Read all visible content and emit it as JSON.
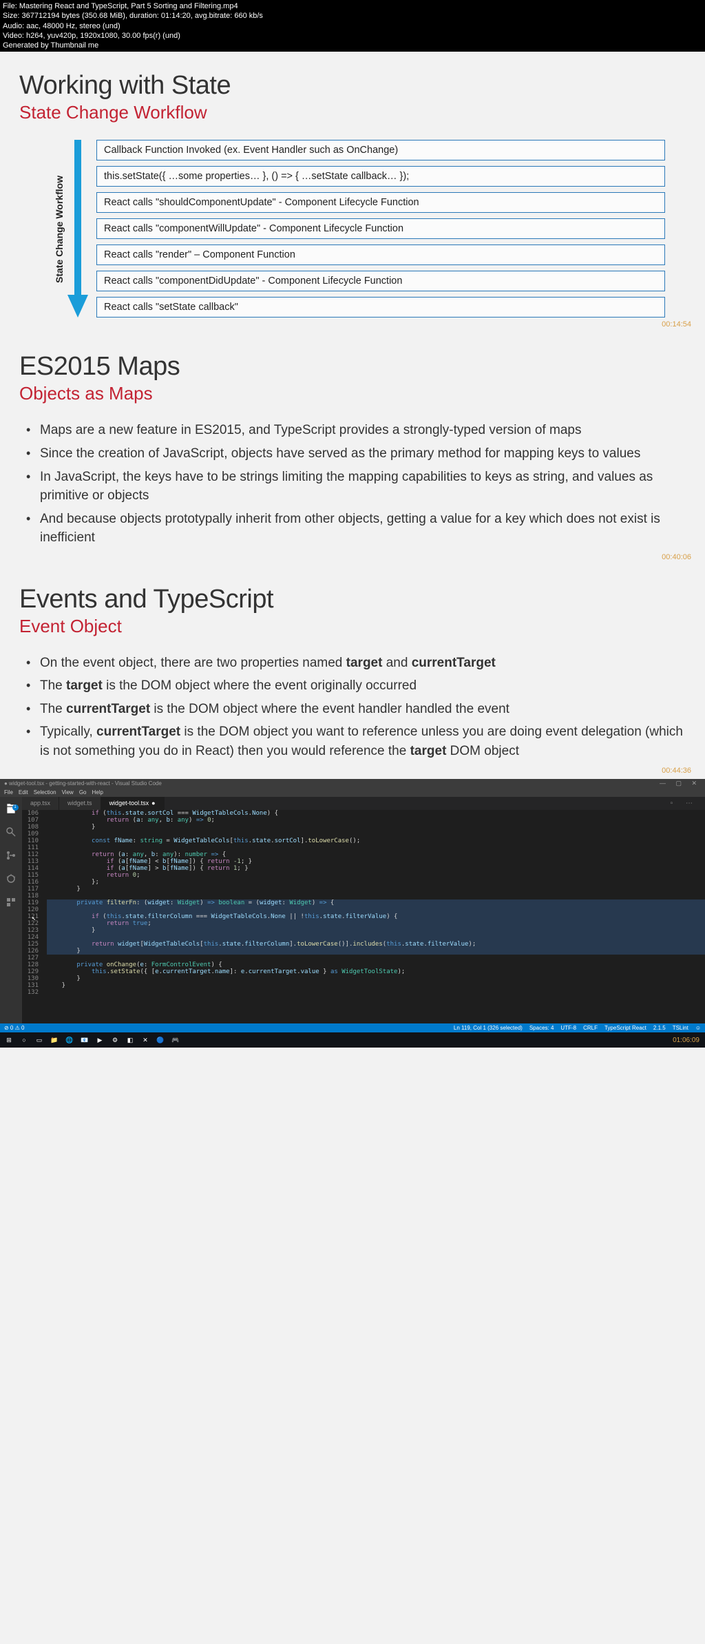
{
  "metadata": {
    "file": "File: Mastering React and TypeScript, Part 5 Sorting and Filtering.mp4",
    "size": "Size: 367712194 bytes (350.68 MiB), duration: 01:14:20, avg.bitrate: 660 kb/s",
    "audio": "Audio: aac, 48000 Hz, stereo (und)",
    "video": "Video: h264, yuv420p, 1920x1080, 30.00 fps(r) (und)",
    "generated": "Generated by Thumbnail me"
  },
  "slide1": {
    "title": "Working with State",
    "subtitle": "State Change Workflow",
    "arrow_label": "State Change Workflow",
    "steps": [
      "Callback Function Invoked (ex. Event Handler such as OnChange)",
      "this.setState({ …some properties… }, () => { …setState callback… });",
      "React calls \"shouldComponentUpdate\" - Component Lifecycle Function",
      "React calls \"componentWillUpdate\" - Component Lifecycle Function",
      "React calls \"render\" – Component Function",
      "React calls \"componentDidUpdate\" - Component Lifecycle Function",
      "React calls \"setState callback\""
    ],
    "timestamp": "00:14:54"
  },
  "slide2": {
    "title": "ES2015 Maps",
    "subtitle": "Objects as Maps",
    "bullets": [
      "Maps are a new feature in ES2015, and TypeScript provides a strongly-typed version of maps",
      "Since the creation of JavaScript, objects have served as the primary method for mapping keys to values",
      "In JavaScript, the keys have to be strings limiting the mapping capabilities to keys as string, and values as primitive or objects",
      "And because objects prototypally inherit from other objects, getting a value for a key which does not exist is inefficient"
    ],
    "timestamp": "00:40:06"
  },
  "slide3": {
    "title": "Events and TypeScript",
    "subtitle": "Event Object",
    "timestamp": "00:44:36"
  },
  "vscode": {
    "title": "● widget-tool.tsx - getting-started-with-react - Visual Studio Code",
    "menu": [
      "File",
      "Edit",
      "Selection",
      "View",
      "Go",
      "Help"
    ],
    "explorer_badge": "1",
    "tabs": [
      {
        "label": "app.tsx",
        "active": false
      },
      {
        "label": "widget.ts",
        "active": false
      },
      {
        "label": "widget-tool.tsx",
        "active": true,
        "dirty": true
      }
    ],
    "code_lines": [
      {
        "n": 106,
        "sel": false,
        "html": "            <span class='tk-ctrl'>if</span> (<span class='tk-this'>this</span>.<span class='tk-var'>state</span>.<span class='tk-var'>sortCol</span> === <span class='tk-var'>WidgetTableCols</span>.<span class='tk-var'>None</span>) {"
      },
      {
        "n": 107,
        "sel": false,
        "html": "                <span class='tk-ctrl'>return</span> (<span class='tk-var'>a</span>: <span class='tk-type'>any</span>, <span class='tk-var'>b</span>: <span class='tk-type'>any</span>) <span class='tk-kw'>=&gt;</span> <span class='tk-num'>0</span>;"
      },
      {
        "n": 108,
        "sel": false,
        "html": "            }"
      },
      {
        "n": 109,
        "sel": false,
        "html": ""
      },
      {
        "n": 110,
        "sel": false,
        "html": "            <span class='tk-kw'>const</span> <span class='tk-var'>fName</span>: <span class='tk-type'>string</span> = <span class='tk-var'>WidgetTableCols</span>[<span class='tk-this'>this</span>.<span class='tk-var'>state</span>.<span class='tk-var'>sortCol</span>].<span class='tk-fn'>toLowerCase</span>();"
      },
      {
        "n": 111,
        "sel": false,
        "html": ""
      },
      {
        "n": 112,
        "sel": false,
        "html": "            <span class='tk-ctrl'>return</span> (<span class='tk-var'>a</span>: <span class='tk-type'>any</span>, <span class='tk-var'>b</span>: <span class='tk-type'>any</span>): <span class='tk-type'>number</span> <span class='tk-kw'>=&gt;</span> {"
      },
      {
        "n": 113,
        "sel": false,
        "html": "                <span class='tk-ctrl'>if</span> (<span class='tk-var'>a</span>[<span class='tk-var'>fName</span>] &lt; <span class='tk-var'>b</span>[<span class='tk-var'>fName</span>]) { <span class='tk-ctrl'>return</span> <span class='tk-num'>-1</span>; }"
      },
      {
        "n": 114,
        "sel": false,
        "html": "                <span class='tk-ctrl'>if</span> (<span class='tk-var'>a</span>[<span class='tk-var'>fName</span>] &gt; <span class='tk-var'>b</span>[<span class='tk-var'>fName</span>]) { <span class='tk-ctrl'>return</span> <span class='tk-num'>1</span>; }"
      },
      {
        "n": 115,
        "sel": false,
        "html": "                <span class='tk-ctrl'>return</span> <span class='tk-num'>0</span>;"
      },
      {
        "n": 116,
        "sel": false,
        "html": "            };"
      },
      {
        "n": 117,
        "sel": false,
        "html": "        }"
      },
      {
        "n": 118,
        "sel": false,
        "html": ""
      },
      {
        "n": 119,
        "sel": true,
        "html": "        <span class='tk-kw'>private</span> <span class='tk-fn'>filterFn</span>: (<span class='tk-var'>widget</span>: <span class='tk-type'>Widget</span>) <span class='tk-kw'>=&gt;</span> <span class='tk-type'>boolean</span> = (<span class='tk-var'>widget</span>: <span class='tk-type'>Widget</span>) <span class='tk-kw'>=&gt;</span> {"
      },
      {
        "n": 120,
        "sel": true,
        "html": ""
      },
      {
        "n": 121,
        "sel": true,
        "html": "            <span class='tk-ctrl'>if</span> (<span class='tk-this'>this</span>.<span class='tk-var'>state</span>.<span class='tk-var'>filterColumn</span> === <span class='tk-var'>WidgetTableCols</span>.<span class='tk-var'>None</span> || !<span class='tk-this'>this</span>.<span class='tk-var'>state</span>.<span class='tk-var'>filterValue</span>) {"
      },
      {
        "n": 122,
        "sel": true,
        "html": "                <span class='tk-ctrl'>return</span> <span class='tk-kw'>true</span>;"
      },
      {
        "n": 123,
        "sel": true,
        "html": "            }"
      },
      {
        "n": 124,
        "sel": true,
        "html": ""
      },
      {
        "n": 125,
        "sel": true,
        "html": "            <span class='tk-ctrl'>return</span> <span class='tk-var'>widget</span>[<span class='tk-var'>WidgetTableCols</span>[<span class='tk-this'>this</span>.<span class='tk-var'>state</span>.<span class='tk-var'>filterColumn</span>].<span class='tk-fn'>toLowerCase</span>()].<span class='tk-fn'>includes</span>(<span class='tk-this'>this</span>.<span class='tk-var'>state</span>.<span class='tk-var'>filterValue</span>);"
      },
      {
        "n": 126,
        "sel": true,
        "html": "        }"
      },
      {
        "n": 127,
        "sel": false,
        "html": ""
      },
      {
        "n": 128,
        "sel": false,
        "html": "        <span class='tk-kw'>private</span> <span class='tk-fn'>onChange</span>(<span class='tk-var'>e</span>: <span class='tk-type'>FormControlEvent</span>) {"
      },
      {
        "n": 129,
        "sel": false,
        "html": "            <span class='tk-this'>this</span>.<span class='tk-fn'>setState</span>({ [<span class='tk-var'>e</span>.<span class='tk-var'>currentTarget</span>.<span class='tk-var'>name</span>]: <span class='tk-var'>e</span>.<span class='tk-var'>currentTarget</span>.<span class='tk-var'>value</span> } <span class='tk-kw'>as</span> <span class='tk-type'>WidgetToolState</span>);"
      },
      {
        "n": 130,
        "sel": false,
        "html": "        }"
      },
      {
        "n": 131,
        "sel": false,
        "html": "    }"
      },
      {
        "n": 132,
        "sel": false,
        "html": ""
      }
    ],
    "status_left": "⊘ 0 ⚠ 0",
    "status_right": [
      "Ln 119, Col 1 (326 selected)",
      "Spaces: 4",
      "UTF-8",
      "CRLF",
      "TypeScript React",
      "2.1.5",
      "TSLint",
      "☺"
    ],
    "timestamp": "01:06:09"
  },
  "taskbar": {
    "icons": [
      "⊞",
      "○",
      "▭",
      "📁",
      "🌐",
      "📧",
      "▶",
      "⚙",
      "◧",
      "✕",
      "🔵",
      "🎮"
    ]
  }
}
